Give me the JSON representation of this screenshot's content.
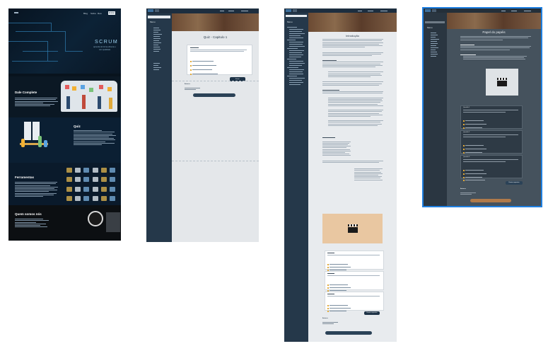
{
  "landing": {
    "nav": [
      "Blog",
      "Sobre",
      "Rea",
      "Login"
    ],
    "nav_button": "Entrar",
    "hero_title": "SCRUM",
    "hero_subtitle": "aprenda de forma eficiente e com qualidade",
    "sections": [
      {
        "title": "Dale Complete"
      },
      {
        "title": "Quiz"
      },
      {
        "title": "Ferramentas"
      },
      {
        "title": "Quem somos nós"
      }
    ]
  },
  "quiz_page": {
    "sidebar_title": "Menu",
    "title": "Quiz - Capitulo 1",
    "options_count": 4,
    "submit_label": "Enviar",
    "footer_label": "Autores:"
  },
  "intro_page": {
    "sidebar_title": "Menu",
    "title": "Introdução",
    "submit_label": "Enviar respostas",
    "footer_label": "Autores:"
  },
  "roles_page": {
    "sidebar_title": "Menu",
    "title": "Papel do papéis",
    "submit_label": "Enviar respostas",
    "footer_label": "Autores:",
    "question_labels": [
      "Questão 1",
      "Questão 2",
      "Questão 3"
    ]
  },
  "colors": {
    "accent_blue": "#1f7fe0",
    "sidebar": "#25384a",
    "highlight": "#e0a93a"
  }
}
